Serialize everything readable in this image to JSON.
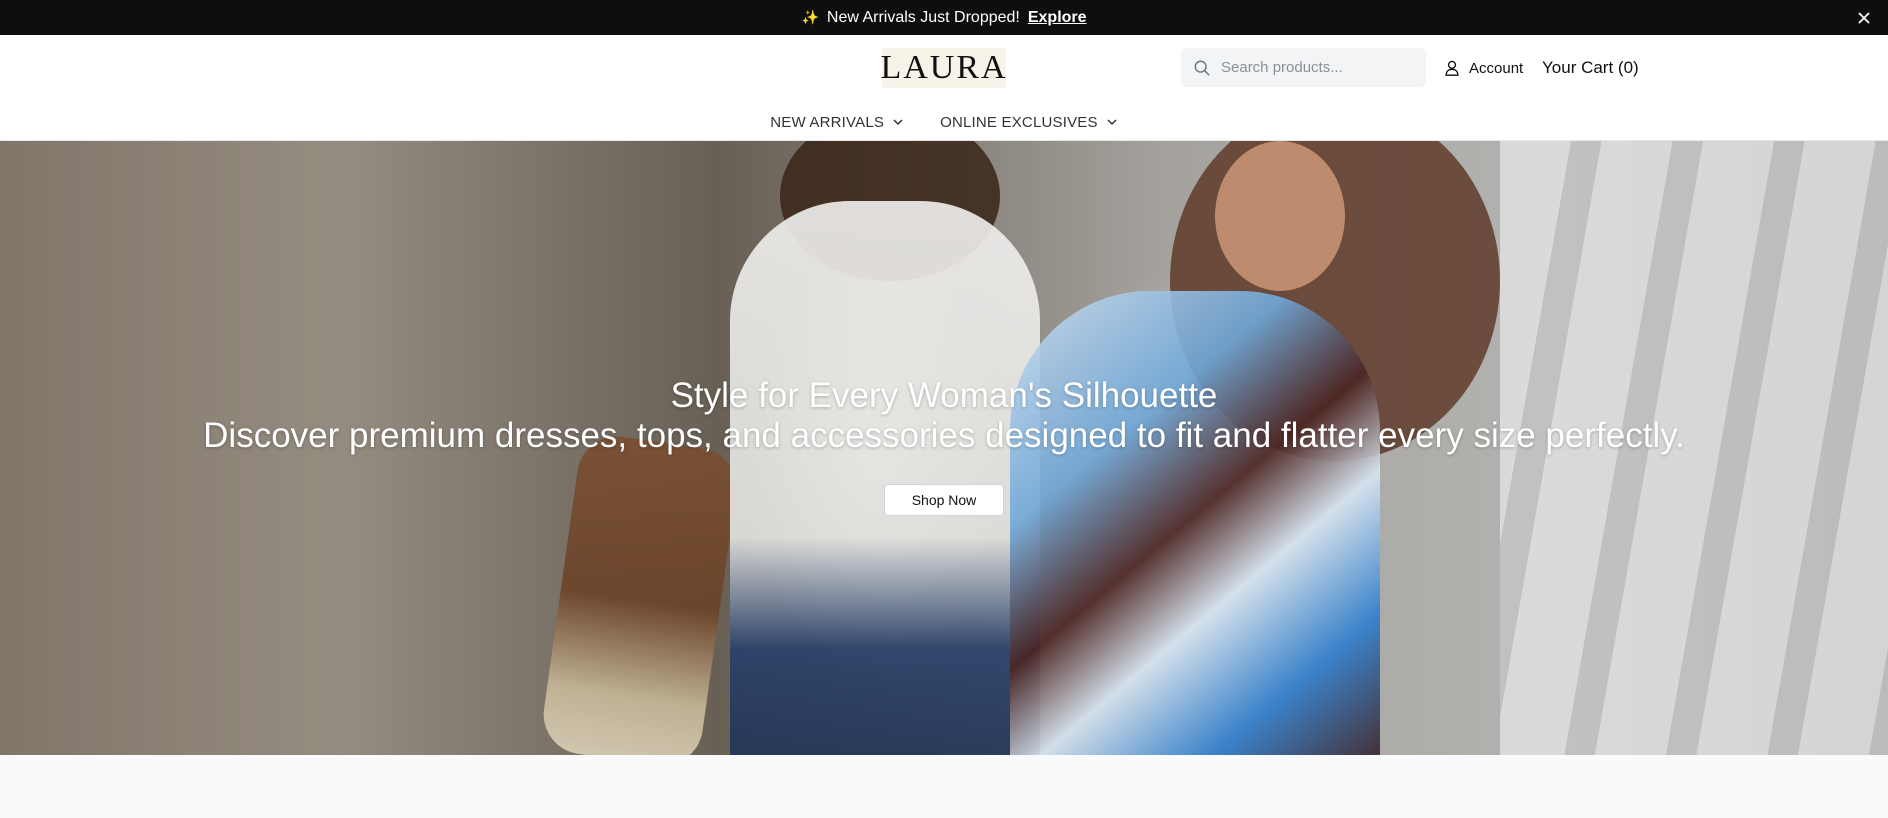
{
  "announcement": {
    "icon": "sparkle-icon",
    "message": "New Arrivals Just Dropped!",
    "link_label": "Explore",
    "close_icon": "close-icon"
  },
  "header": {
    "logo_text": "LAURA",
    "search": {
      "placeholder": "Search products..."
    },
    "account_label": "Account",
    "cart_label": "Your Cart (0)"
  },
  "nav": {
    "items": [
      {
        "label": "NEW ARRIVALS",
        "icon": "chevron-down-icon"
      },
      {
        "label": "ONLINE EXCLUSIVES",
        "icon": "chevron-down-icon"
      }
    ]
  },
  "hero": {
    "title": "Style for Every Woman's Silhouette",
    "subtitle": "Discover premium dresses, tops, and accessories designed to fit and flatter every size perfectly.",
    "cta_label": "Shop Now"
  },
  "colors": {
    "announcement_bg": "#0e0e0e",
    "logo_bg": "#f7f3e8",
    "search_bg": "#f3f4f6",
    "page_bg": "#f9fafb"
  }
}
